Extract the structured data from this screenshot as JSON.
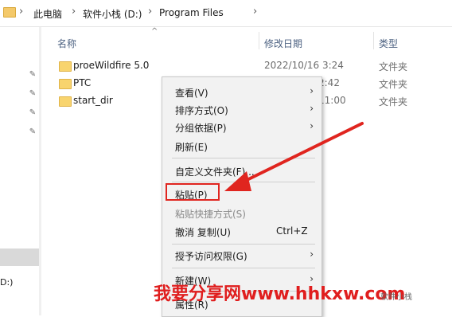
{
  "address_bar": {
    "crumbs": [
      "此电脑",
      "软件小栈 (D:)",
      "Program Files"
    ],
    "separator": "›"
  },
  "columns": {
    "name": "名称",
    "modified": "修改日期",
    "type": "类型"
  },
  "files": [
    {
      "name": "proeWildfire 5.0",
      "date": "2022/10/16 3:24",
      "type": "文件夹"
    },
    {
      "name": "PTC",
      "date": "2:42",
      "type": "文件夹"
    },
    {
      "name": "start_dir",
      "date": "11:00",
      "type": "文件夹"
    }
  ],
  "nav": {
    "drive_fragment": "D:)"
  },
  "context_menu": {
    "items": [
      {
        "label": "查看(V)",
        "submenu": true
      },
      {
        "label": "排序方式(O)",
        "submenu": true
      },
      {
        "label": "分组依据(P)",
        "submenu": true
      },
      {
        "label": "刷新(E)"
      },
      {
        "label": "自定义文件夹(F)..."
      },
      {
        "label": "粘贴(P)",
        "highlighted": true
      },
      {
        "label": "粘贴快捷方式(S)",
        "disabled": true
      },
      {
        "label": "撤消 复制(U)",
        "shortcut": "Ctrl+Z"
      },
      {
        "label": "授予访问权限(G)",
        "submenu": true
      },
      {
        "label": "新建(W)",
        "submenu": true
      },
      {
        "label": "属性(R)"
      }
    ],
    "arrow_glyph": "›"
  },
  "annotation": {
    "color": "#e0251f"
  },
  "watermark": {
    "text": "我要分享网www.hhkxw.com",
    "sub": "软件小栈"
  },
  "icons": {
    "folder": "folder-icon",
    "pin": "pin-icon",
    "sort": "sort-up-icon"
  },
  "sort_glyph": "^",
  "pin_glyph": "✎"
}
